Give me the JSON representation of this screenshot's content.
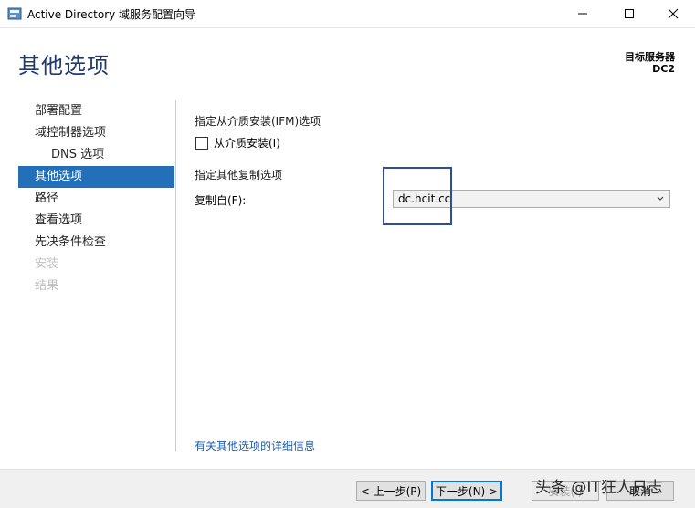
{
  "window": {
    "title": "Active Directory 域服务配置向导",
    "icon": "ad-wizard-icon"
  },
  "header": {
    "title": "其他选项",
    "target_label": "目标服务器",
    "target_name": "DC2"
  },
  "nav": {
    "items": [
      {
        "label": "部署配置",
        "state": "normal"
      },
      {
        "label": "域控制器选项",
        "state": "normal"
      },
      {
        "label": "DNS 选项",
        "state": "sub"
      },
      {
        "label": "其他选项",
        "state": "active"
      },
      {
        "label": "路径",
        "state": "normal"
      },
      {
        "label": "查看选项",
        "state": "normal"
      },
      {
        "label": "先决条件检查",
        "state": "normal"
      },
      {
        "label": "安装",
        "state": "disabled"
      },
      {
        "label": "结果",
        "state": "disabled"
      }
    ]
  },
  "content": {
    "ifm_section": "指定从介质安装(IFM)选项",
    "ifm_checkbox": "从介质安装(I)",
    "ifm_checked": false,
    "replication_section": "指定其他复制选项",
    "replicate_from_label": "复制自(F):",
    "replicate_from_value": "dc.hcit.cc",
    "more_info_link": "有关其他选项的详细信息"
  },
  "footer": {
    "prev": "< 上一步(P)",
    "next": "下一步(N) >",
    "install": "安装(I)",
    "cancel": "取消"
  },
  "watermark": "头条 @IT狂人日志",
  "colors": {
    "accent": "#2370b8",
    "heading": "#1e3a6e",
    "link": "#1a5fb4",
    "highlight_box": "#2b4f9e"
  }
}
